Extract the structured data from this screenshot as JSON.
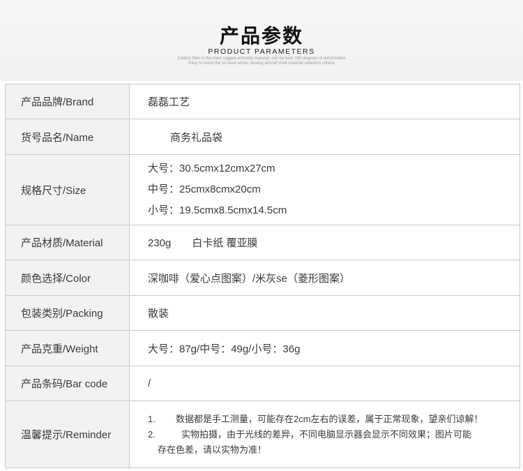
{
  "header": {
    "title": "产品参数",
    "subtitle": "PRODUCT PARAMETERS",
    "tagline_1": "Carbon fiber is the most rugged umbrella material, can be bent 180 degrees of deformation",
    "tagline_2": "Easy to resist the 10 level winds, Boeing aircraft shell material selection criteria"
  },
  "params": {
    "brand": {
      "label": "产品品牌/Brand",
      "value": "磊磊工艺"
    },
    "name": {
      "label": "货号品名/Name",
      "value": "商务礼品袋"
    },
    "size": {
      "label": "规格尺寸/Size",
      "lines": [
        "大号：30.5cmx12cmx27cm",
        "中号：25cmx8cmx20cm",
        "小号：19.5cmx8.5cmx14.5cm"
      ]
    },
    "material": {
      "label": "产品材质/Material",
      "value": "230g　　白卡纸 覆亚膜"
    },
    "color": {
      "label": "颜色选择/Color",
      "value": "深咖啡（爱心点图案）/米灰se（菱形图案）"
    },
    "packing": {
      "label": "包装类别/Packing",
      "value": "散装"
    },
    "weight": {
      "label": "产品克重/Weight",
      "value": "大号：87g/中号：49g/小号：36g"
    },
    "barcode": {
      "label": "产品条码/Bar code",
      "value": "/"
    },
    "reminder": {
      "label": "温馨提示/Reminder",
      "item1_num": "1.",
      "item1_text": "数据都是手工测量，可能存在2cm左右的误差，属于正常现象，望亲们谅解！",
      "item2_num": "2.",
      "item2_text": "实物拍摄，由于光线的差异，不同电脑显示器会显示不同效果；图片可能",
      "item2_cont": "存在色差，请以实物为准！"
    }
  }
}
